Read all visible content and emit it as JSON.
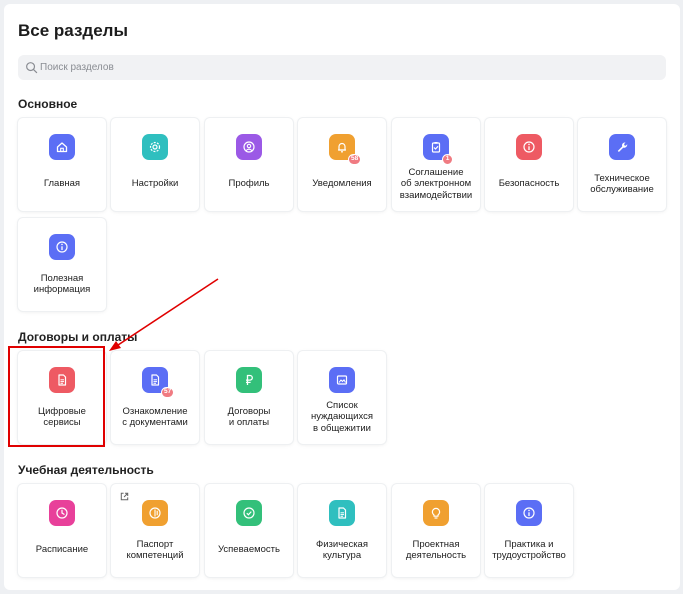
{
  "page": {
    "title": "Все разделы"
  },
  "search": {
    "placeholder": "Поиск разделов",
    "value": ""
  },
  "sections": {
    "main": {
      "title": "Основное",
      "items": [
        {
          "label": "Главная",
          "icon": "home-icon",
          "color": "#5b6ef5"
        },
        {
          "label": "Настройки",
          "icon": "gear-icon",
          "color": "#2fbfbf"
        },
        {
          "label": "Профиль",
          "icon": "user-circle-icon",
          "color": "#9b59e6"
        },
        {
          "label": "Уведомления",
          "icon": "bell-icon",
          "color": "#f0a030",
          "badge": "58"
        },
        {
          "label": "Соглашение\nоб электронном\nвзаимодействии",
          "icon": "clipboard-check-icon",
          "color": "#5b6ef5",
          "badge": "1"
        },
        {
          "label": "Безопасность",
          "icon": "info-icon",
          "color": "#ee5a63"
        },
        {
          "label": "Техническое\nобслуживание",
          "icon": "wrench-icon",
          "color": "#5b6ef5"
        },
        {
          "label": "Полезная\nинформация",
          "icon": "info-icon",
          "color": "#5b6ef5"
        }
      ]
    },
    "contracts": {
      "title": "Договоры и оплаты",
      "items": [
        {
          "label": "Цифровые\nсервисы",
          "icon": "document-icon",
          "color": "#ee5a63"
        },
        {
          "label": "Ознакомление\nс документами",
          "icon": "document-icon",
          "color": "#5b6ef5",
          "badge": "57"
        },
        {
          "label": "Договоры\nи оплаты",
          "icon": "ruble-icon",
          "color": "#33c07a"
        },
        {
          "label": "Список\nнуждающихся\nв общежитии",
          "icon": "image-icon",
          "color": "#5b6ef5"
        }
      ]
    },
    "study": {
      "title": "Учебная деятельность",
      "items": [
        {
          "label": "Расписание",
          "icon": "clock-icon",
          "color": "#e8409a"
        },
        {
          "label": "Паспорт\nкомпетенций",
          "icon": "compass-icon",
          "color": "#f0a030",
          "external": "external-link-icon"
        },
        {
          "label": "Успеваемость",
          "icon": "check-circle-icon",
          "color": "#33c07a"
        },
        {
          "label": "Физическая\nкультура",
          "icon": "document-icon",
          "color": "#2fbfbf"
        },
        {
          "label": "Проектная\nдеятельность",
          "icon": "lightbulb-icon",
          "color": "#f0a030"
        },
        {
          "label": "Практика и\nтрудоустройство",
          "icon": "info-icon",
          "color": "#5b6ef5"
        }
      ]
    }
  },
  "colors": {
    "highlight": "#e00000",
    "badge": "#f07b82"
  }
}
